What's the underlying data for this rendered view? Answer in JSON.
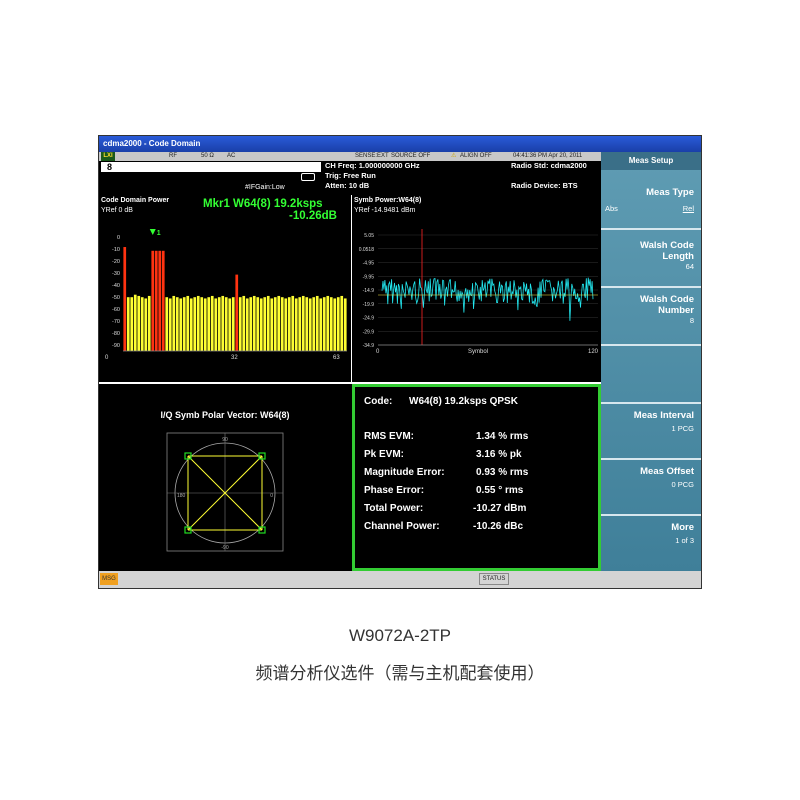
{
  "window": {
    "title": "cdma2000 - Code Domain"
  },
  "status_bar": {
    "logo": "LXI",
    "rf": "RF",
    "impedance": "50 Ω",
    "coupling": "AC",
    "sense": "SENSE:EXT",
    "source": "SOURCE OFF",
    "align": "ALIGN OFF",
    "datetime": "04:41:36 PM Apr 20, 2011"
  },
  "info": {
    "channel_number": "8",
    "ch_freq": "CH Freq: 1.000000000 GHz",
    "trig": "Trig: Free Run",
    "atten": "Atten: 10 dB",
    "if_gain": "#IFGain:Low",
    "radio_std": "Radio Std: cdma2000",
    "radio_device": "Radio Device: BTS"
  },
  "code_domain": {
    "title": "Code Domain Power",
    "yref": "YRef  0 dB",
    "marker_line1": "Mkr1 W64(8) 19.2ksps",
    "marker_line2": "-10.26dB",
    "marker_label": "1",
    "y_ticks": [
      "0",
      "-10",
      "-20",
      "-30",
      "-40",
      "-50",
      "-60",
      "-70",
      "-80",
      "-90"
    ],
    "x_ticks": [
      "0",
      "32",
      "63"
    ],
    "bar_color": "#ffff33",
    "active_color": "#ff3311",
    "bars_db": [
      -8,
      -48,
      -48,
      -46,
      -47,
      -48,
      -49,
      -47,
      -11,
      -11,
      -11,
      -11,
      -48,
      -49,
      -47,
      -48,
      -49,
      -48,
      -47,
      -49,
      -48,
      -47,
      -48,
      -49,
      -48,
      -47,
      -49,
      -48,
      -47,
      -48,
      -49,
      -48,
      -30,
      -48,
      -47,
      -49,
      -48,
      -47,
      -48,
      -49,
      -48,
      -47,
      -49,
      -48,
      -47,
      -48,
      -49,
      -48,
      -47,
      -49,
      -48,
      -47,
      -48,
      -49,
      -48,
      -47,
      -49,
      -48,
      -47,
      -48,
      -49,
      -48,
      -47,
      -49
    ],
    "active_codes": [
      0,
      8,
      9,
      10,
      11,
      32
    ]
  },
  "symb_power": {
    "title": "Symb Power:W64(8)",
    "yref": "YRef  -14.9481 dBm",
    "y_ticks": [
      "5.05",
      "0.0518",
      "-4.95",
      "-9.95",
      "-14.9",
      "-19.9",
      "-24.9",
      "-29.9",
      "-34.9"
    ],
    "x_ticks": [
      "0",
      "Symbol",
      "120"
    ],
    "trace_color": "#22e8f0"
  },
  "polar": {
    "title": "I/Q Symb Polar Vector: W64(8)",
    "angle_labels": [
      "90",
      "180",
      "0",
      "-90"
    ],
    "trace_color": "#ffff33",
    "point_color": "#22dd22"
  },
  "evm": {
    "code_label": "Code:",
    "code_value": "W64(8) 19.2ksps QPSK",
    "rows": [
      {
        "label": "RMS EVM:",
        "value": "1.34 % rms"
      },
      {
        "label": "Pk EVM:",
        "value": "3.16 % pk"
      },
      {
        "label": "Magnitude Error:",
        "value": "0.93 % rms"
      },
      {
        "label": "Phase Error:",
        "value": "0.55 ° rms"
      },
      {
        "label": "Total Power:",
        "value": "-10.27 dBm"
      },
      {
        "label": "Channel Power:",
        "value": "-10.26 dBc"
      }
    ],
    "border_color": "#33cc33"
  },
  "softkeys": {
    "header": "Meas Setup",
    "meas_type": {
      "label": "Meas Type",
      "opt_left": "Abs",
      "opt_right": "Rel"
    },
    "walsh_length": {
      "label1": "Walsh Code",
      "label2": "Length",
      "value": "64"
    },
    "walsh_number": {
      "label1": "Walsh Code",
      "label2": "Number",
      "value": "8"
    },
    "meas_interval": {
      "label": "Meas Interval",
      "value": "1 PCG"
    },
    "meas_offset": {
      "label": "Meas Offset",
      "value": "0 PCG"
    },
    "more": {
      "label": "More",
      "value": "1 of 3"
    }
  },
  "bottom_bar": {
    "msg": "MSG",
    "status": "STATUS"
  },
  "caption": {
    "model": "W9072A-2TP",
    "desc": "频谱分析仪选件（需与主机配套使用）"
  }
}
